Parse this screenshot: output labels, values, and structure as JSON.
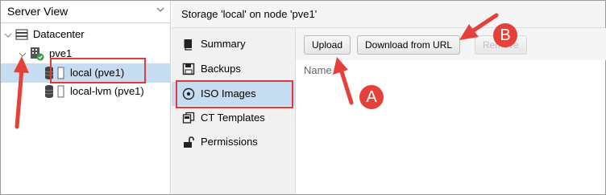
{
  "window_title": "Storage 'local' on node 'pve1'",
  "view_selector": {
    "label": "Server View"
  },
  "tree": {
    "datacenter": "Datacenter",
    "node": "pve1",
    "storages": [
      {
        "label": "local (pve1)",
        "selected": true
      },
      {
        "label": "local-lvm (pve1)",
        "selected": false
      }
    ]
  },
  "nav": {
    "items": [
      {
        "label": "Summary",
        "icon": "book-icon"
      },
      {
        "label": "Backups",
        "icon": "floppy-icon"
      },
      {
        "label": "ISO Images",
        "icon": "disc-icon",
        "selected": true
      },
      {
        "label": "CT Templates",
        "icon": "template-icon"
      },
      {
        "label": "Permissions",
        "icon": "unlock-icon"
      }
    ]
  },
  "toolbar": {
    "upload_label": "Upload",
    "download_label": "Download from URL",
    "remove_label": "Remove"
  },
  "grid": {
    "column_name": "Name"
  },
  "annotations": {
    "badge_a": "A",
    "badge_b": "B",
    "color": "#e6403a"
  }
}
